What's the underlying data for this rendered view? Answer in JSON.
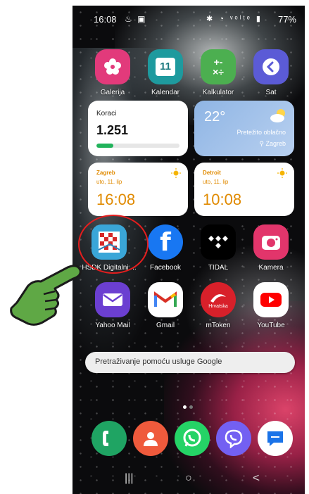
{
  "status_bar": {
    "time": "16:08",
    "left_icons": "♨ ▣",
    "right_icons": "✱ ◔ ᵛᵒˡᵗᵉ ▮",
    "battery": "77%"
  },
  "apps_row1": [
    {
      "label": "Galerija",
      "icon": "flower-icon",
      "color": "#e23a7b"
    },
    {
      "label": "Kalendar",
      "icon": "calendar-icon",
      "color": "#1e9a9e",
      "glyph": "11"
    },
    {
      "label": "Kalkulator",
      "icon": "calculator-icon",
      "color": "#4caf50",
      "glyph": "+-\n×÷"
    },
    {
      "label": "Sat",
      "icon": "clock-icon",
      "color": "#5b5bd6"
    }
  ],
  "widgets": {
    "steps": {
      "title": "Koraci",
      "count": "1.251",
      "progress": 0.2
    },
    "weather": {
      "temp": "22°",
      "condition": "Pretežito oblačno",
      "city": "Zagreb"
    },
    "clock1": {
      "city": "Zagreb",
      "date": "uto, 11. lip",
      "time": "16:08"
    },
    "clock2": {
      "city": "Detroit",
      "date": "uto, 11. lip",
      "time": "10:08"
    }
  },
  "apps_row2": [
    {
      "label": "HSDK Digitalni ...",
      "icon": "hsdk-icon"
    },
    {
      "label": "Facebook",
      "icon": "facebook-icon",
      "color": "#1877f2",
      "glyph": "f"
    },
    {
      "label": "TIDAL",
      "icon": "tidal-icon",
      "color": "#000000"
    },
    {
      "label": "Kamera",
      "icon": "camera-icon",
      "color": "#e2356b"
    }
  ],
  "apps_row3": [
    {
      "label": "Yahoo Mail",
      "icon": "mail-icon",
      "color": "#6b3fd1"
    },
    {
      "label": "Gmail",
      "icon": "gmail-icon",
      "color": "#ffffff"
    },
    {
      "label": "mToken",
      "icon": "mtoken-icon",
      "color": "#d8202a",
      "glyph": "Hrvatska"
    },
    {
      "label": "YouTube",
      "icon": "youtube-icon",
      "color": "#ffffff"
    }
  ],
  "search": {
    "placeholder": "Pretraživanje pomoću usluge Google"
  },
  "dock": [
    {
      "icon": "phone-icon",
      "color": "#1fa463"
    },
    {
      "icon": "contacts-icon",
      "color": "#ef5a3c"
    },
    {
      "icon": "whatsapp-icon",
      "color": "#25d366"
    },
    {
      "icon": "viber-icon",
      "color": "#7360f2"
    },
    {
      "icon": "messages-icon",
      "color": "#ffffff"
    }
  ],
  "navbar": {
    "recents": "|||",
    "home": "○",
    "back": "<"
  }
}
